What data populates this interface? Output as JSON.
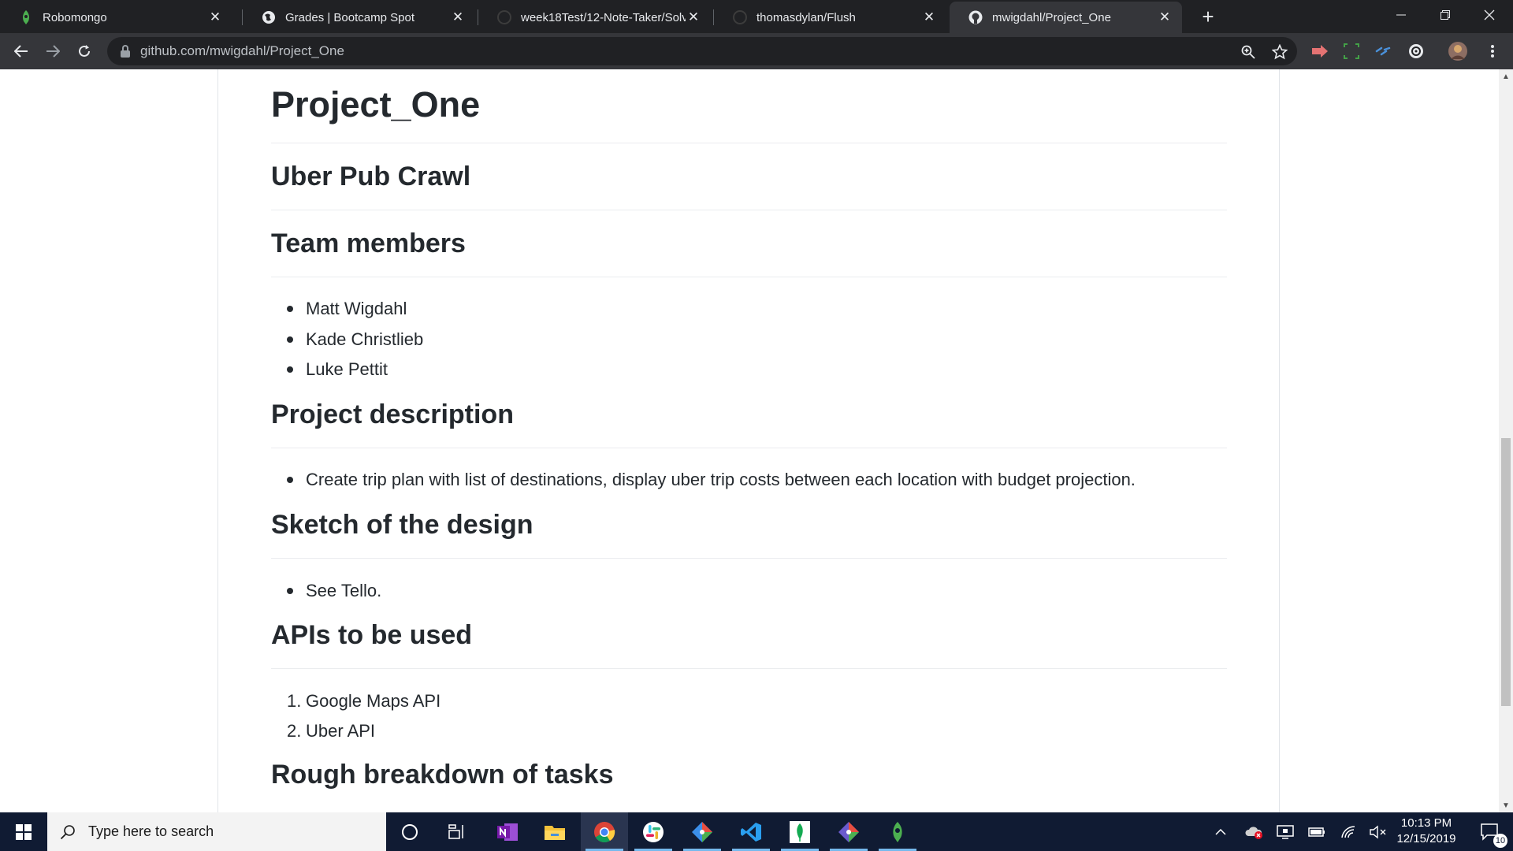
{
  "browser": {
    "tabs": [
      {
        "title": "Robomongo",
        "favicon": "robomongo-icon"
      },
      {
        "title": "Grades | Bootcamp Spot",
        "favicon": "globe-icon"
      },
      {
        "title": "week18Test/12-Note-Taker/Solve",
        "favicon": "github-icon"
      },
      {
        "title": "thomasdylan/Flush",
        "favicon": "github-icon"
      },
      {
        "title": "mwigdahl/Project_One",
        "favicon": "github-icon",
        "active": true
      }
    ],
    "new_tab": "+",
    "close_glyph": "✕",
    "url": "github.com/mwigdahl/Project_One"
  },
  "readme": {
    "title": "Project_One",
    "subtitle": "Uber Pub Crawl",
    "team_heading": "Team members",
    "team": [
      "Matt Wigdahl",
      "Kade Christlieb",
      "Luke Pettit"
    ],
    "description_heading": "Project description",
    "description": [
      "Create trip plan with list of destinations, display uber trip costs between each location with budget projection."
    ],
    "sketch_heading": "Sketch of the design",
    "sketch": [
      "See Tello."
    ],
    "apis_heading": "APIs to be used",
    "apis": [
      "Google Maps API",
      "Uber API"
    ],
    "api_numbers": [
      "1.",
      "2."
    ],
    "tasks_heading": "Rough breakdown of tasks"
  },
  "taskbar": {
    "search_placeholder": "Type here to search",
    "time": "10:13 PM",
    "date": "12/15/2019",
    "notification_count": "10"
  },
  "colors": {
    "chrome_dark": "#202124",
    "chrome_toolbar": "#35363a",
    "text": "#24292e",
    "taskbar": "#101b33"
  }
}
